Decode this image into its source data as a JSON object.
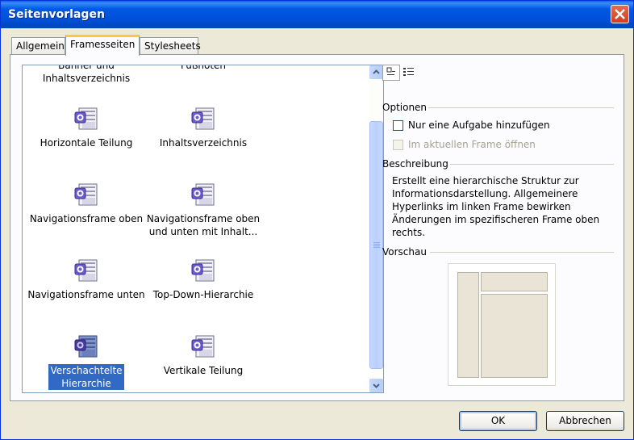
{
  "window": {
    "title": "Seitenvorlagen"
  },
  "tabs": [
    {
      "label": "Allgemein"
    },
    {
      "label": "Framesseiten"
    },
    {
      "label": "Stylesheets"
    }
  ],
  "templates": {
    "items": [
      {
        "label_line1": "Banner und",
        "label_line2": "Inhaltsverzeichnis"
      },
      {
        "label_line1": "Fußnoten",
        "label_line2": ""
      },
      {
        "label_line1": "Horizontale Teilung",
        "label_line2": ""
      },
      {
        "label_line1": "Inhaltsverzeichnis",
        "label_line2": ""
      },
      {
        "label_line1": "Navigationsframe oben",
        "label_line2": ""
      },
      {
        "label_line1": "Navigationsframe oben",
        "label_line2": "und unten mit Inhalt..."
      },
      {
        "label_line1": "Navigationsframe unten",
        "label_line2": ""
      },
      {
        "label_line1": "Top-Down-Hierarchie",
        "label_line2": ""
      },
      {
        "label_line1": "Verschachtelte",
        "label_line2": "Hierarchie"
      },
      {
        "label_line1": "Vertikale Teilung",
        "label_line2": ""
      }
    ],
    "selected": "Verschachtelte Hierarchie"
  },
  "options": {
    "title": "Optionen",
    "single_task": {
      "label": "Nur eine Aufgabe hinzufügen",
      "checked": false
    },
    "open_in_frame": {
      "label": "Im aktuellen Frame öffnen",
      "checked": false,
      "enabled": false
    }
  },
  "description": {
    "title": "Beschreibung",
    "text": "Erstellt eine hierarchische Struktur zur Informationsdarstellung. Allgemeinere Hyperlinks im linken Frame bewirken Änderungen im spezifischeren Frame oben rechts."
  },
  "preview": {
    "title": "Vorschau"
  },
  "buttons": {
    "ok": "OK",
    "cancel": "Abbrechen"
  },
  "colors": {
    "titlebar": "#0054e3",
    "selection": "#316ac5",
    "tab_highlight": "#ffc83c"
  }
}
